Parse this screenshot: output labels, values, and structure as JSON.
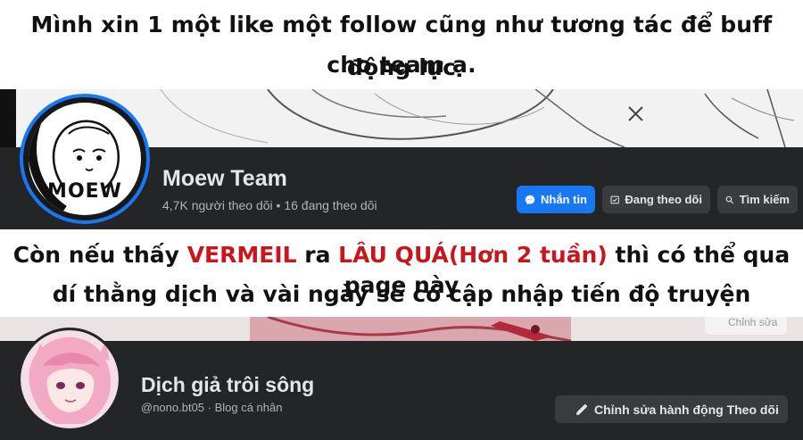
{
  "top_banner": {
    "line1": "Mình xin 1 một like một follow cũng như tương tác để buff động lực",
    "line2": "cho team ạ."
  },
  "page1": {
    "name": "Moew Team",
    "stats": "4,7K người theo dõi • 16 đang theo dõi",
    "avatar_text": "MOEW",
    "buttons": {
      "message": "Nhắn tin",
      "following": "Đang theo dõi",
      "search": "Tìm kiếm"
    },
    "icons": {
      "message": "messenger-icon",
      "following": "following-check-icon",
      "search": "search-icon"
    },
    "accent": "#1877f2"
  },
  "notice": {
    "line1_a": "Còn nếu thấy ",
    "line1_red1": "VERMEIL",
    "line1_b": " ra ",
    "line1_red2": "LÂU QUÁ(Hơn 2 tuần)",
    "line1_c": " thì có thể qua page này",
    "line2": "dí thằng dịch và vài ngày sẽ có cập nhập tiến độ truyện",
    "red_color": "#c8161d"
  },
  "page2": {
    "cover_button": "Chỉnh sửa",
    "name": "Dịch giả trôi sông",
    "stats": "@nono.bt05 · Blog cá nhân",
    "edit_button": "Chỉnh sửa hành động Theo dõi",
    "icons": {
      "edit": "pencil-icon"
    }
  },
  "colors": {
    "dark_bg": "#242526",
    "button_bg": "#3a3b3c",
    "text_primary": "#e4e6eb",
    "text_secondary": "#b0b3b8"
  }
}
